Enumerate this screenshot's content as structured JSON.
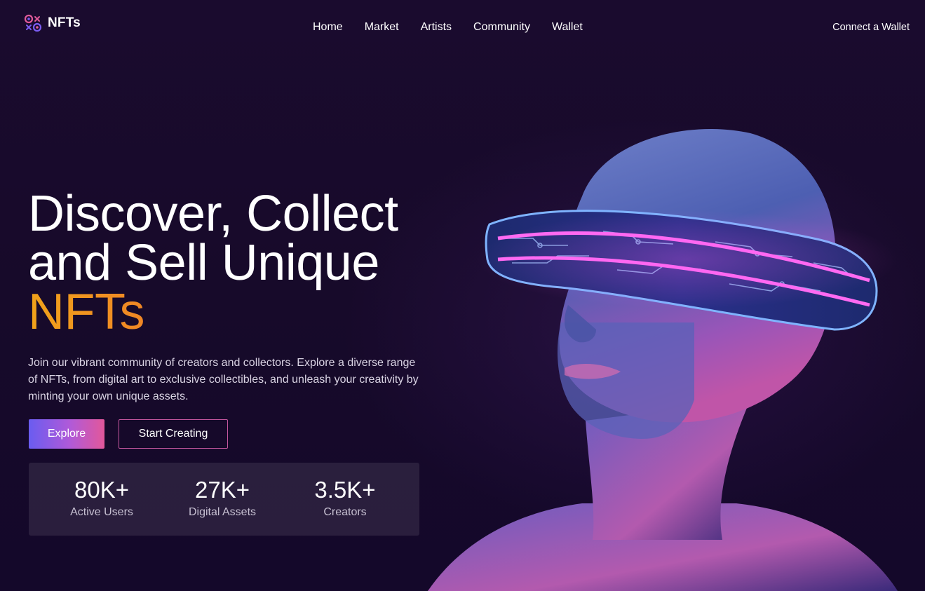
{
  "header": {
    "logo_text": "NFTs",
    "nav": [
      "Home",
      "Market",
      "Artists",
      "Community",
      "Wallet"
    ],
    "connect_label": "Connect a Wallet"
  },
  "hero": {
    "headline_line1": "Discover, Collect",
    "headline_line2": "and Sell Unique",
    "headline_accent": "NFTs",
    "description": "Join our vibrant community of creators and collectors. Explore a diverse range of NFTs, from digital art to exclusive collectibles, and unleash your creativity by minting your own unique assets.",
    "explore_label": "Explore",
    "create_label": "Start Creating",
    "image_icon": "vr-headset-bust-illustration"
  },
  "stats": [
    {
      "value": "80K+",
      "label": "Active Users"
    },
    {
      "value": "27K+",
      "label": "Digital Assets"
    },
    {
      "value": "3.5K+",
      "label": "Creators"
    }
  ],
  "colors": {
    "background": "#180a2a",
    "accent_orange": "#f0a21a",
    "accent_pink": "#e2579a",
    "accent_purple": "#6a5cf0"
  }
}
